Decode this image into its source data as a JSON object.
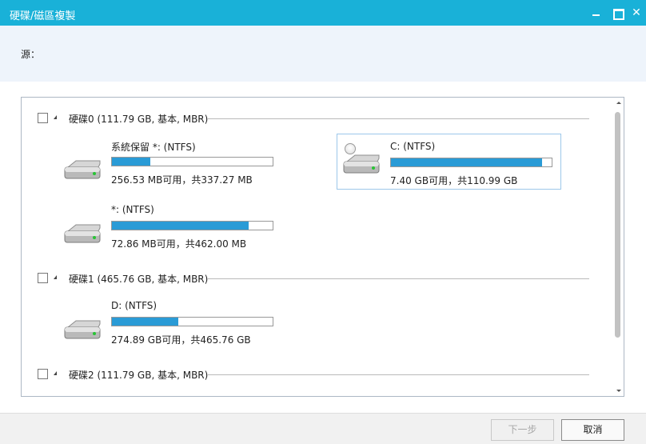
{
  "window": {
    "title": "硬碟/磁區複製",
    "close_glyph": "✕"
  },
  "source": {
    "label": "源："
  },
  "disks": [
    {
      "label": "硬碟0 (111.79 GB, 基本, MBR)",
      "partitions": [
        {
          "name": "系統保留 *: (NTFS)",
          "info": "256.53 MB可用，共337.27 MB",
          "used_fraction": 0.24,
          "selected": false
        },
        {
          "name": "C: (NTFS)",
          "info": "7.40 GB可用，共110.99 GB",
          "used_fraction": 0.94,
          "selected": true
        },
        {
          "name": "*: (NTFS)",
          "info": "72.86 MB可用，共462.00 MB",
          "used_fraction": 0.85,
          "selected": false
        }
      ]
    },
    {
      "label": "硬碟1 (465.76 GB, 基本, MBR)",
      "partitions": [
        {
          "name": "D: (NTFS)",
          "info": "274.89 GB可用，共465.76 GB",
          "used_fraction": 0.41,
          "selected": false
        }
      ]
    },
    {
      "label": "硬碟2 (111.79 GB, 基本, MBR)",
      "partitions": []
    }
  ],
  "footer": {
    "next_label": "下一步",
    "cancel_label": "取消"
  },
  "colors": {
    "titlebar": "#19b1d8",
    "bar_fill": "#2a9bd6",
    "selection_border": "#9dc7ea"
  }
}
